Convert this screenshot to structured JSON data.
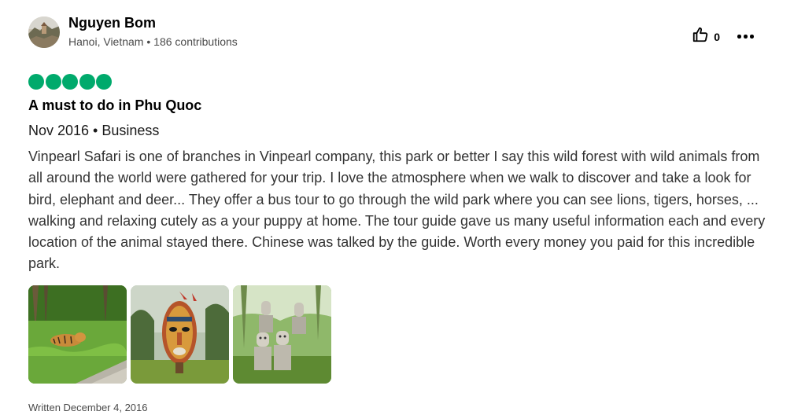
{
  "reviewer": {
    "name": "Nguyen Bom",
    "location": "Hanoi, Vietnam",
    "separator": " • ",
    "contributions": "186 contributions"
  },
  "actions": {
    "helpful_icon": "thumbs-up-icon",
    "helpful_count": "0",
    "more_icon": "more-options-icon"
  },
  "rating": {
    "value": 5,
    "max": 5,
    "color": "#00aa6c"
  },
  "review": {
    "title": "A must to do in Phu Quoc",
    "trip_date": "Nov 2016 • Business",
    "body": "Vinpearl Safari is one of branches in Vinpearl company, this park or better I say this wild forest with wild animals from all around the world were gathered for your trip. I love the atmosphere when we walk to discover and take a look for bird, elephant and deer... They offer a bus tour to go through the wild park where you can see lions, tigers, horses, ... walking and relaxing cutely as a your puppy at home. The tour guide gave us many useful information each and every location of the animal stayed there. Chinese was talked by the guide. Worth every money you paid for this incredible park.",
    "photos": [
      {
        "subject": "tiger-in-grass-photo"
      },
      {
        "subject": "tribal-mask-sculpture-photo"
      },
      {
        "subject": "stone-statues-photo"
      }
    ],
    "written_date": "Written December 4, 2016"
  }
}
